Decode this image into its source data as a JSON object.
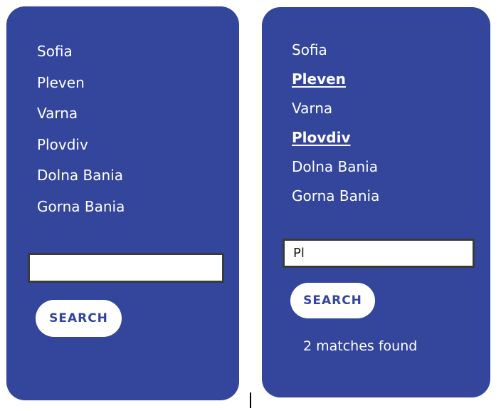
{
  "before": {
    "towns": [
      "Sofia",
      "Pleven",
      "Varna",
      "Plovdiv",
      "Dolna Bania",
      "Gorna Bania"
    ],
    "search_value": "",
    "button_label": "SEARCH"
  },
  "after": {
    "towns": [
      "Sofia",
      "Pleven",
      "Varna",
      "Plovdiv",
      "Dolna Bania",
      "Gorna Bania"
    ],
    "search_value": "Pl",
    "button_label": "SEARCH",
    "status": "2 matches found"
  },
  "colors": {
    "panel": "#34469c",
    "text": "#ffffff",
    "button_text": "#34469c",
    "input_border": "#3a3a3a"
  }
}
